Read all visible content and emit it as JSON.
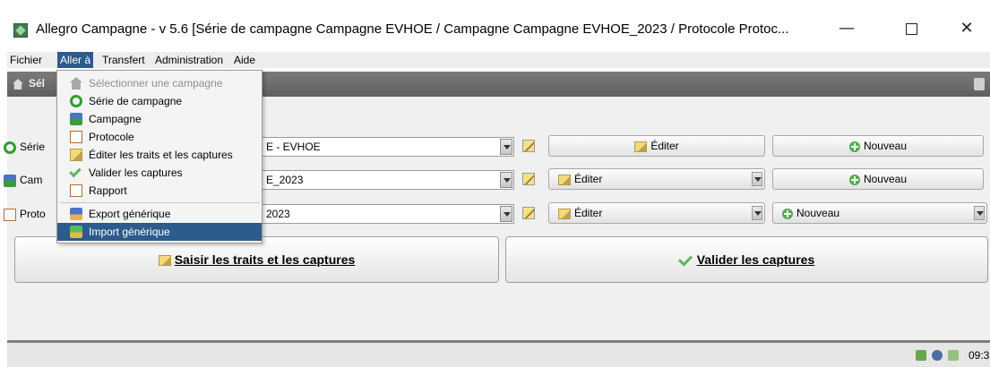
{
  "window": {
    "title": "Allegro Campagne - v 5.6 [Série de campagne Campagne EVHOE / Campagne Campagne EVHOE_2023 / Protocole Protoc...",
    "minimize": "—",
    "close": "✕"
  },
  "menubar": {
    "items": [
      "Fichier",
      "Aller à",
      "Transfert",
      "Administration",
      "Aide"
    ]
  },
  "toolbar": {
    "label": "Sél"
  },
  "dropdown": {
    "items": [
      {
        "label": "Sélectionner une campagne",
        "icon": "house-icon",
        "state": "disabled"
      },
      {
        "label": "Série de campagne",
        "icon": "series-icon",
        "state": "normal"
      },
      {
        "label": "Campagne",
        "icon": "campaign-icon",
        "state": "normal"
      },
      {
        "label": "Protocole",
        "icon": "protocol-icon",
        "state": "normal"
      },
      {
        "label": "Éditer les traits et les captures",
        "icon": "edit-icon",
        "state": "normal"
      },
      {
        "label": "Valider les captures",
        "icon": "check-icon",
        "state": "normal"
      },
      {
        "label": "Rapport",
        "icon": "report-icon",
        "state": "normal"
      },
      {
        "label": "Export générique",
        "icon": "export-icon",
        "state": "normal"
      },
      {
        "label": "Import générique",
        "icon": "import-icon",
        "state": "selected"
      }
    ]
  },
  "form": {
    "serie": {
      "label": "Série",
      "value": "E - EVHOE",
      "edit_label": "Éditer",
      "new_label": "Nouveau"
    },
    "campagne": {
      "label": "Cam",
      "value": "E_2023",
      "edit_label": "Éditer",
      "new_label": "Nouveau"
    },
    "protocole": {
      "label": "Proto",
      "value": "2023",
      "edit_label": "Éditer",
      "new_label": "Nouveau"
    }
  },
  "actions": {
    "saisir_label": "Saisir les traits et les captures",
    "valider_label": "Valider les captures"
  },
  "status": {
    "time": "09:3"
  },
  "colors": {
    "menu_highlight": "#2c5b8c",
    "toolbar_dark": "#6a6a6a",
    "panel_bg": "#f0f0f0",
    "accent_green": "#5cb85c"
  }
}
